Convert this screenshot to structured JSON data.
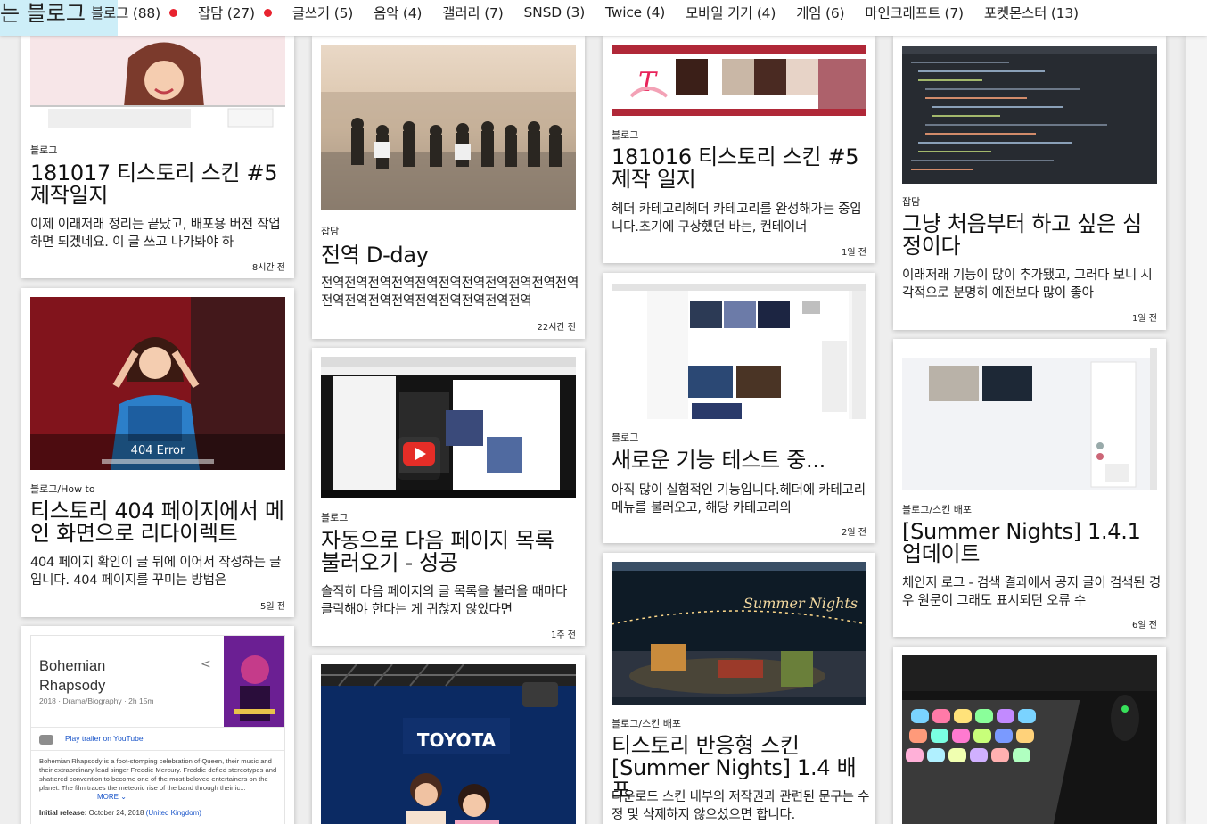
{
  "nav": {
    "logo": "는 블로그",
    "items": [
      {
        "label": "블로그 (88)",
        "dot": true
      },
      {
        "label": "잡담 (27)",
        "dot": true
      },
      {
        "label": "글쓰기 (5)",
        "dot": false
      },
      {
        "label": "음악 (4)",
        "dot": false
      },
      {
        "label": "갤러리 (7)",
        "dot": false
      },
      {
        "label": "SNSD (3)",
        "dot": false
      },
      {
        "label": "Twice (4)",
        "dot": false
      },
      {
        "label": "모바일 기기 (4)",
        "dot": false
      },
      {
        "label": "게임 (6)",
        "dot": false
      },
      {
        "label": "마인크래프트 (7)",
        "dot": false
      },
      {
        "label": "포켓몬스터 (13)",
        "dot": false
      }
    ],
    "dot_color": "#e8232f"
  },
  "posts": [
    {
      "category": "블로그",
      "title": "181017 티스토리 스킨 #5 제작일지",
      "excerpt": "이제 이래저래 정리는 끝났고, 배포용 버전 작업하면 되겠네요. 이 글 쓰고 나가봐야 하",
      "time": "8시간 전"
    },
    {
      "category": "블로그/How to",
      "title": "티스토리 404 페이지에서 메인 화면으로 리다이렉트",
      "excerpt": "404 페이지 확인이 글 뒤에 이어서 작성하는 글입니다. 404 페이지를 꾸미는 방법은",
      "time": "5일 전",
      "thumb_text": "404 Error"
    },
    {
      "category": "잡담",
      "title": "전역 D-day",
      "excerpt": "전역전역전역전역전역전역전역전역전역전역전역전역전역전역전역전역전역전역전역전역",
      "time": "22시간 전"
    },
    {
      "category": "블로그",
      "title": "자동으로 다음 페이지 목록 불러오기 - 성공",
      "excerpt": "솔직히 다음 페이지의 글 목록을 불러올 때마다 클릭해야 한다는 게 귀찮지 않았다면",
      "time": "1주 전"
    },
    {
      "category": "블로그",
      "title": "181016 티스토리 스킨 #5 제작 일지",
      "excerpt": "헤더 카테고리헤더 카테고리를 완성해가는 중입니다.초기에 구상했던 바는, 컨테이너",
      "time": "1일 전"
    },
    {
      "category": "블로그",
      "title": "새로운 기능 테스트 중...",
      "excerpt": "아직 많이 실험적인 기능입니다.헤더에 카테고리 메뉴를 불러오고, 해당 카테고리의",
      "time": "2일 전"
    },
    {
      "category": "블로그/스킨 배포",
      "title": "티스토리 반응형 스킨 [Summer Nights] 1.4 배포",
      "excerpt": "다운로드 스킨 내부의 저작권과 관련된 문구는 수정 및 삭제하지 않으셨으면 합니다.",
      "time": "",
      "thumb_text": "Summer Nights"
    },
    {
      "category": "잡담",
      "title": "그냥 처음부터 하고 싶은 심정이다",
      "excerpt": "이래저래 기능이 많이 추가됐고, 그러다 보니 시각적으로 분명히 예전보다 많이 좋아",
      "time": "1일 전"
    },
    {
      "category": "블로그/스킨 배포",
      "title": "[Summer Nights] 1.4.1 업데이트",
      "excerpt": "체인지 로그 - 검색 결과에서 공지 글이 검색된 경우 원문이 그래도 표시되던 오류 수",
      "time": "6일 전"
    }
  ],
  "movie_card": {
    "title": "Bohemian Rhapsody",
    "meta": "2018 · Drama/Biography · 2h 15m",
    "trailer": "Play trailer on YouTube",
    "description": "Bohemian Rhapsody is a foot-stomping celebration of Queen, their music and their extraordinary lead singer Freddie Mercury. Freddie defied stereotypes and shattered convention to become one of the most beloved entertainers on the planet. The film traces the meteoric rise of the band through their ic...",
    "more": "MORE",
    "release_label": "Initial release:",
    "release_value": "October 24, 2018",
    "release_country": "(United Kingdom)"
  },
  "banner_text": "TOYOTA",
  "colors": {
    "accent": "#e8232f",
    "logo_bg": "#cdeef8"
  }
}
